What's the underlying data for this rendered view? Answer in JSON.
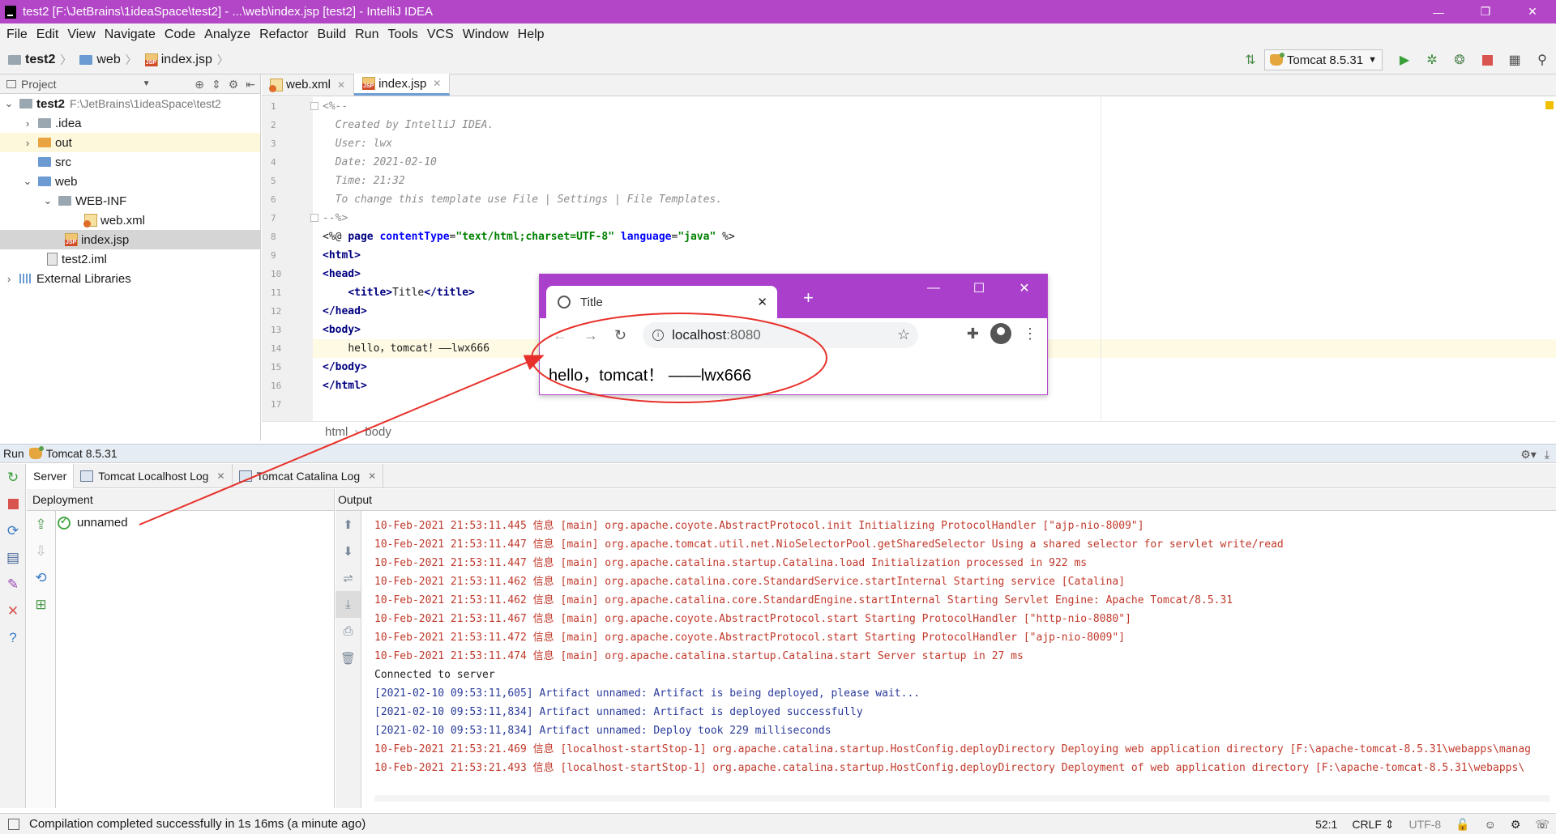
{
  "window": {
    "title": "test2 [F:\\JetBrains\\1ideaSpace\\test2] - ...\\web\\index.jsp [test2] - IntelliJ IDEA",
    "controls": [
      "—",
      "❐",
      "✕"
    ]
  },
  "menu": [
    "File",
    "Edit",
    "View",
    "Navigate",
    "Code",
    "Analyze",
    "Refactor",
    "Build",
    "Run",
    "Tools",
    "VCS",
    "Window",
    "Help"
  ],
  "breadcrumb": [
    "test2",
    "web",
    "index.jsp"
  ],
  "run_config": "Tomcat 8.5.31",
  "project": {
    "header": "Project",
    "tree": [
      {
        "label": "test2",
        "path": "F:\\JetBrains\\1ideaSpace\\test2"
      },
      {
        "label": ".idea"
      },
      {
        "label": "out"
      },
      {
        "label": "src"
      },
      {
        "label": "web"
      },
      {
        "label": "WEB-INF"
      },
      {
        "label": "web.xml"
      },
      {
        "label": "index.jsp"
      },
      {
        "label": "test2.iml"
      },
      {
        "label": "External Libraries"
      }
    ]
  },
  "editor": {
    "tabs": [
      "web.xml",
      "index.jsp"
    ],
    "line_numbers": [
      "1",
      "2",
      "3",
      "4",
      "5",
      "6",
      "7",
      "8",
      "9",
      "10",
      "11",
      "12",
      "13",
      "14",
      "15",
      "16",
      "17"
    ],
    "comment": {
      "open": "<%--",
      "l2": "  Created by IntelliJ IDEA.",
      "l3": "  User: lwx",
      "l4": "  Date: 2021-02-10",
      "l5": "  Time: 21:32",
      "l6": "  To change this template use File | Settings | File Templates.",
      "close": "--%>"
    },
    "directive": {
      "open": "<%@ ",
      "page": "page",
      "ct_attr": "contentType",
      "ct_val": "\"text/html;charset=UTF-8\"",
      "lang_attr": "language",
      "lang_val": "\"java\"",
      "close": " %>"
    },
    "tags": {
      "html_open": "<html>",
      "head_open": "<head>",
      "title_open": "<title>",
      "title_text": "Title",
      "title_close": "</title>",
      "head_close": "</head>",
      "body_open": "<body>",
      "body_text": "hello，tomcat！——lwx666",
      "body_close": "</body>",
      "html_close": "</html>"
    },
    "breadcrumbs": [
      "html",
      "body"
    ]
  },
  "browser": {
    "tab_title": "Title",
    "url_host": "localhost",
    "url_port": ":8080",
    "content": "hello，tomcat！ ——lwx666"
  },
  "run": {
    "label": "Run",
    "config": "Tomcat 8.5.31",
    "tabs": [
      "Server",
      "Tomcat Localhost Log",
      "Tomcat Catalina Log"
    ],
    "deployment_header": "Deployment",
    "output_header": "Output",
    "artifact": "unnamed",
    "log": [
      {
        "kind": "err",
        "text": "10-Feb-2021 21:53:11.445 信息 [main] org.apache.coyote.AbstractProtocol.init Initializing ProtocolHandler [\"ajp-nio-8009\"]"
      },
      {
        "kind": "err",
        "text": "10-Feb-2021 21:53:11.447 信息 [main] org.apache.tomcat.util.net.NioSelectorPool.getSharedSelector Using a shared selector for servlet write/read"
      },
      {
        "kind": "err",
        "text": "10-Feb-2021 21:53:11.447 信息 [main] org.apache.catalina.startup.Catalina.load Initialization processed in 922 ms"
      },
      {
        "kind": "err",
        "text": "10-Feb-2021 21:53:11.462 信息 [main] org.apache.catalina.core.StandardService.startInternal Starting service [Catalina]"
      },
      {
        "kind": "err",
        "text": "10-Feb-2021 21:53:11.462 信息 [main] org.apache.catalina.core.StandardEngine.startInternal Starting Servlet Engine: Apache Tomcat/8.5.31"
      },
      {
        "kind": "err",
        "text": "10-Feb-2021 21:53:11.467 信息 [main] org.apache.coyote.AbstractProtocol.start Starting ProtocolHandler [\"http-nio-8080\"]"
      },
      {
        "kind": "err",
        "text": "10-Feb-2021 21:53:11.472 信息 [main] org.apache.coyote.AbstractProtocol.start Starting ProtocolHandler [\"ajp-nio-8009\"]"
      },
      {
        "kind": "err",
        "text": "10-Feb-2021 21:53:11.474 信息 [main] org.apache.catalina.startup.Catalina.start Server startup in 27 ms"
      },
      {
        "kind": "norm",
        "text": "Connected to server"
      },
      {
        "kind": "info",
        "text": "[2021-02-10 09:53:11,605] Artifact unnamed: Artifact is being deployed, please wait..."
      },
      {
        "kind": "info",
        "text": "[2021-02-10 09:53:11,834] Artifact unnamed: Artifact is deployed successfully"
      },
      {
        "kind": "info",
        "text": "[2021-02-10 09:53:11,834] Artifact unnamed: Deploy took 229 milliseconds"
      },
      {
        "kind": "err",
        "text": "10-Feb-2021 21:53:21.469 信息 [localhost-startStop-1] org.apache.catalina.startup.HostConfig.deployDirectory Deploying web application directory [F:\\apache-tomcat-8.5.31\\webapps\\manag"
      },
      {
        "kind": "err",
        "text": "10-Feb-2021 21:53:21.493 信息 [localhost-startStop-1] org.apache.catalina.startup.HostConfig.deployDirectory Deployment of web application directory [F:\\apache-tomcat-8.5.31\\webapps\\"
      }
    ]
  },
  "status": {
    "message": "Compilation completed successfully in 1s 16ms (a minute ago)",
    "position": "52:1",
    "line_sep": "CRLF",
    "encoding": "UTF-8"
  },
  "colors": {
    "titlebar": "#b246c6",
    "annotation": "#e8302a",
    "log_error_red": "#c0392b",
    "log_info_blue": "#2a3b9a"
  }
}
